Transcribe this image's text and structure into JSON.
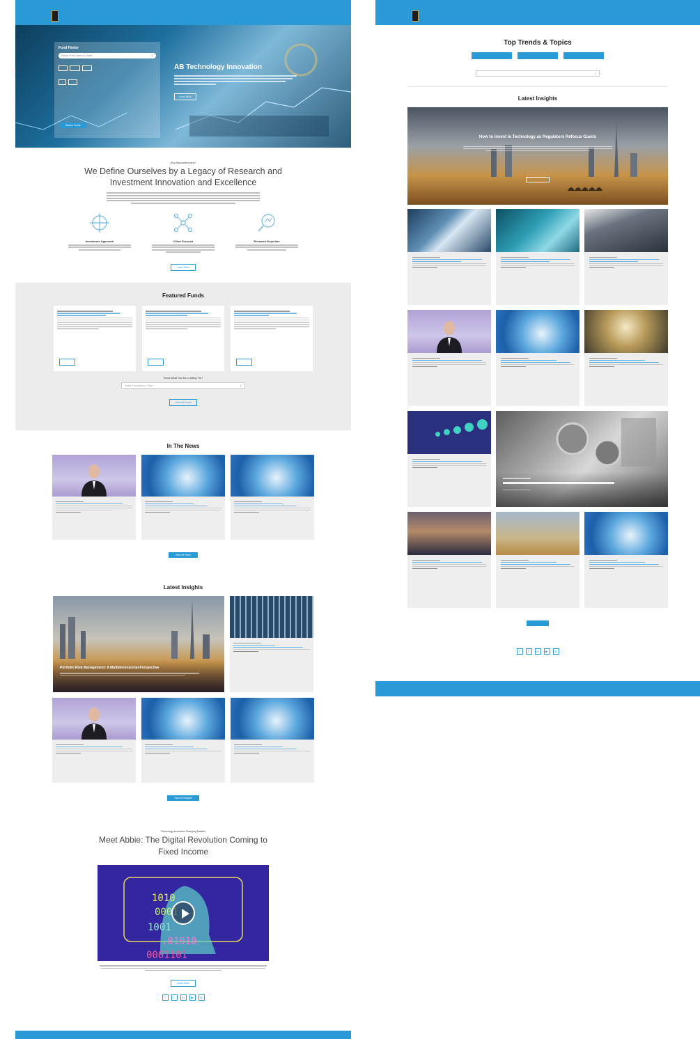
{
  "left": {
    "hero": {
      "title": "AB Technology Innovation",
      "fund_finder_title": "Fund Finder",
      "fund_finder_placeholder": "Search Fund Name or Ticker",
      "button": "Learn More",
      "ff_button": "Search Funds"
    },
    "intro": {
      "eyebrow": "Why AllianceBernstein?",
      "heading": "We Define Ourselves by a Legacy of Research and Investment Innovation and Excellence",
      "features": [
        {
          "title": "Investment Approach",
          "icon": "crosshair-icon"
        },
        {
          "title": "Client Focused",
          "icon": "network-icon"
        },
        {
          "title": "Research Expertise",
          "icon": "magnifier-icon"
        }
      ],
      "button": "Learn More"
    },
    "featured": {
      "heading": "Featured Funds",
      "lookfor_label": "Know What You Are Looking For?",
      "lookfor_placeholder": "Search Fund Name or Ticker",
      "button": "View All Funds"
    },
    "news": {
      "heading": "In The News",
      "button": "View All News"
    },
    "insights": {
      "heading": "Latest Insights",
      "big_title": "Portfolio Risk Management: A Multidimensional Perspective",
      "button": "View All Insights"
    },
    "abbie": {
      "eyebrow": "Technology Innovation Changing Markets",
      "heading": "Meet Abbie: The Digital Revolution Coming to Fixed Income",
      "button": "Learn More"
    }
  },
  "right": {
    "trends_title": "Top Trends & Topics",
    "latest_heading": "Latest Insights",
    "feature_title": "How to Invest in Technology as Regulators Refocus Giants"
  },
  "colors": {
    "brand": "#2a9ad6",
    "band": "#ececec"
  }
}
